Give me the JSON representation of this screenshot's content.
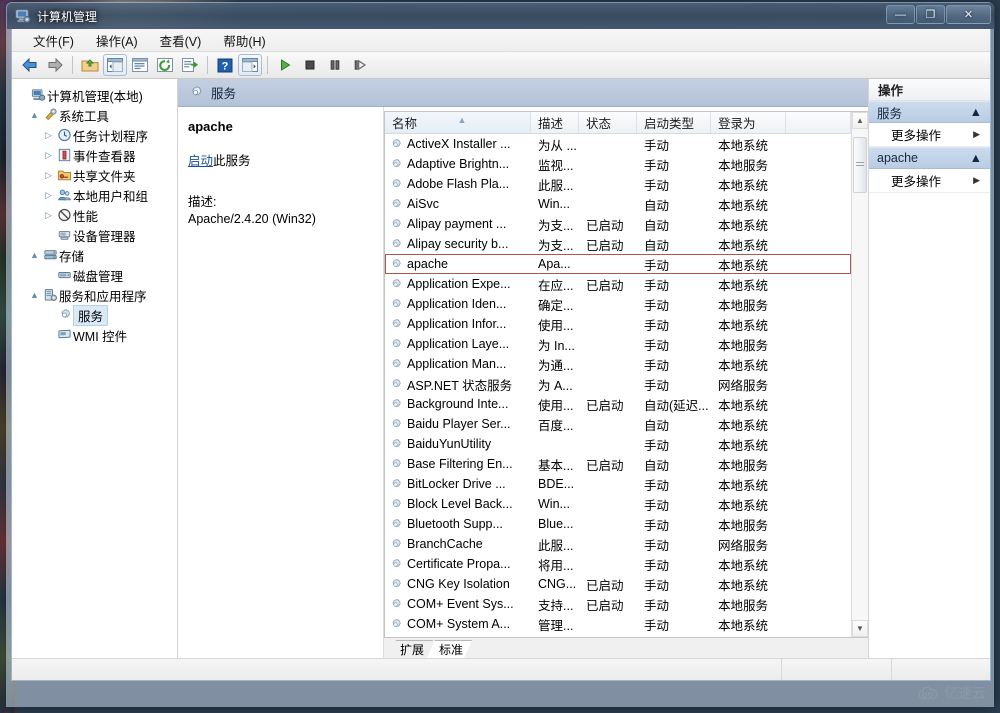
{
  "window": {
    "title": "计算机管理",
    "icon": "computer-management-icon",
    "buttons": {
      "minimize": "—",
      "maximize": "❐",
      "close": "✕"
    }
  },
  "menubar": {
    "items": [
      {
        "label": "文件(F)",
        "name": "menu-file"
      },
      {
        "label": "操作(A)",
        "name": "menu-action"
      },
      {
        "label": "查看(V)",
        "name": "menu-view"
      },
      {
        "label": "帮助(H)",
        "name": "menu-help"
      }
    ]
  },
  "toolbar": {
    "buttons": [
      {
        "name": "back-icon",
        "glyph": "back"
      },
      {
        "name": "forward-icon",
        "glyph": "forward"
      },
      {
        "name": "up-folder-icon",
        "glyph": "upfolder"
      },
      {
        "name": "show-hide-tree-icon",
        "glyph": "treepane"
      },
      {
        "name": "properties-icon",
        "glyph": "props"
      },
      {
        "name": "refresh-icon",
        "glyph": "refresh"
      },
      {
        "name": "export-list-icon",
        "glyph": "export"
      },
      {
        "name": "help-icon",
        "glyph": "help"
      },
      {
        "name": "show-action-pane-icon",
        "glyph": "actionpane"
      },
      {
        "name": "start-service-icon",
        "glyph": "play"
      },
      {
        "name": "stop-service-icon",
        "glyph": "stop"
      },
      {
        "name": "pause-service-icon",
        "glyph": "pause"
      },
      {
        "name": "restart-service-icon",
        "glyph": "restart"
      }
    ]
  },
  "tree": {
    "items": [
      {
        "label": "计算机管理(本地)",
        "indent": 0,
        "expander": "",
        "icon": "computer-icon",
        "name": "tree-computer-management"
      },
      {
        "label": "系统工具",
        "indent": 1,
        "expander": "▲",
        "icon": "tools-icon",
        "name": "tree-system-tools"
      },
      {
        "label": "任务计划程序",
        "indent": 2,
        "expander": "▷",
        "icon": "clock-icon",
        "name": "tree-task-scheduler"
      },
      {
        "label": "事件查看器",
        "indent": 2,
        "expander": "▷",
        "icon": "event-icon",
        "name": "tree-event-viewer"
      },
      {
        "label": "共享文件夹",
        "indent": 2,
        "expander": "▷",
        "icon": "shared-folder-icon",
        "name": "tree-shared-folders"
      },
      {
        "label": "本地用户和组",
        "indent": 2,
        "expander": "▷",
        "icon": "users-icon",
        "name": "tree-local-users-groups"
      },
      {
        "label": "性能",
        "indent": 2,
        "expander": "▷",
        "icon": "performance-icon",
        "name": "tree-performance"
      },
      {
        "label": "设备管理器",
        "indent": 2,
        "expander": "",
        "icon": "device-manager-icon",
        "name": "tree-device-manager"
      },
      {
        "label": "存储",
        "indent": 1,
        "expander": "▲",
        "icon": "storage-icon",
        "name": "tree-storage"
      },
      {
        "label": "磁盘管理",
        "indent": 2,
        "expander": "",
        "icon": "disk-icon",
        "name": "tree-disk-management"
      },
      {
        "label": "服务和应用程序",
        "indent": 1,
        "expander": "▲",
        "icon": "services-apps-icon",
        "name": "tree-services-applications"
      },
      {
        "label": "服务",
        "indent": 2,
        "expander": "",
        "icon": "gear-icon",
        "name": "tree-services",
        "selected": true
      },
      {
        "label": "WMI 控件",
        "indent": 2,
        "expander": "",
        "icon": "wmi-icon",
        "name": "tree-wmi-control"
      }
    ]
  },
  "services_header": {
    "title": "服务",
    "icon": "gear-icon"
  },
  "detail": {
    "service_name": "apache",
    "action_link": "启动",
    "action_suffix": "此服务",
    "description_label": "描述:",
    "description_value": "Apache/2.4.20 (Win32)"
  },
  "list": {
    "columns": [
      {
        "label": "名称",
        "key": "name",
        "sorted": true
      },
      {
        "label": "描述",
        "key": "description"
      },
      {
        "label": "状态",
        "key": "status"
      },
      {
        "label": "启动类型",
        "key": "startup"
      },
      {
        "label": "登录为",
        "key": "logon"
      }
    ],
    "rows": [
      {
        "name": "ActiveX Installer ...",
        "description": "为从 ...",
        "status": "",
        "startup": "手动",
        "logon": "本地系统"
      },
      {
        "name": "Adaptive Brightn...",
        "description": "监视...",
        "status": "",
        "startup": "手动",
        "logon": "本地服务"
      },
      {
        "name": "Adobe Flash Pla...",
        "description": "此服...",
        "status": "",
        "startup": "手动",
        "logon": "本地系统"
      },
      {
        "name": "AiSvc",
        "description": "Win...",
        "status": "",
        "startup": "自动",
        "logon": "本地系统"
      },
      {
        "name": "Alipay payment ...",
        "description": "为支...",
        "status": "已启动",
        "startup": "自动",
        "logon": "本地系统"
      },
      {
        "name": "Alipay security b...",
        "description": "为支...",
        "status": "已启动",
        "startup": "自动",
        "logon": "本地系统"
      },
      {
        "name": "apache",
        "description": "Apa...",
        "status": "",
        "startup": "手动",
        "logon": "本地系统",
        "selected": true
      },
      {
        "name": "Application Expe...",
        "description": "在应...",
        "status": "已启动",
        "startup": "手动",
        "logon": "本地系统"
      },
      {
        "name": "Application Iden...",
        "description": "确定...",
        "status": "",
        "startup": "手动",
        "logon": "本地服务"
      },
      {
        "name": "Application Infor...",
        "description": "使用...",
        "status": "",
        "startup": "手动",
        "logon": "本地系统"
      },
      {
        "name": "Application Laye...",
        "description": "为 In...",
        "status": "",
        "startup": "手动",
        "logon": "本地服务"
      },
      {
        "name": "Application Man...",
        "description": "为通...",
        "status": "",
        "startup": "手动",
        "logon": "本地系统"
      },
      {
        "name": "ASP.NET 状态服务",
        "description": "为 A...",
        "status": "",
        "startup": "手动",
        "logon": "网络服务"
      },
      {
        "name": "Background Inte...",
        "description": "使用...",
        "status": "已启动",
        "startup": "自动(延迟...",
        "logon": "本地系统"
      },
      {
        "name": "Baidu Player Ser...",
        "description": "百度...",
        "status": "",
        "startup": "自动",
        "logon": "本地系统"
      },
      {
        "name": "BaiduYunUtility",
        "description": "",
        "status": "",
        "startup": "手动",
        "logon": "本地系统"
      },
      {
        "name": "Base Filtering En...",
        "description": "基本...",
        "status": "已启动",
        "startup": "自动",
        "logon": "本地服务"
      },
      {
        "name": "BitLocker Drive ...",
        "description": "BDE...",
        "status": "",
        "startup": "手动",
        "logon": "本地系统"
      },
      {
        "name": "Block Level Back...",
        "description": "Win...",
        "status": "",
        "startup": "手动",
        "logon": "本地系统"
      },
      {
        "name": "Bluetooth Supp...",
        "description": "Blue...",
        "status": "",
        "startup": "手动",
        "logon": "本地服务"
      },
      {
        "name": "BranchCache",
        "description": "此服...",
        "status": "",
        "startup": "手动",
        "logon": "网络服务"
      },
      {
        "name": "Certificate Propa...",
        "description": "将用...",
        "status": "",
        "startup": "手动",
        "logon": "本地系统"
      },
      {
        "name": "CNG Key Isolation",
        "description": "CNG...",
        "status": "已启动",
        "startup": "手动",
        "logon": "本地系统"
      },
      {
        "name": "COM+ Event Sys...",
        "description": "支持...",
        "status": "已启动",
        "startup": "手动",
        "logon": "本地服务"
      },
      {
        "name": "COM+ System A...",
        "description": "管理...",
        "status": "",
        "startup": "手动",
        "logon": "本地系统"
      }
    ]
  },
  "view_tabs": [
    {
      "label": "扩展",
      "name": "tab-extended",
      "active": false
    },
    {
      "label": "标准",
      "name": "tab-standard",
      "active": true
    }
  ],
  "actions": {
    "header": "操作",
    "groups": [
      {
        "title": "服务",
        "name": "actions-group-services",
        "items": [
          {
            "label": "更多操作",
            "name": "more-actions-services"
          }
        ]
      },
      {
        "title": "apache",
        "name": "actions-group-apache",
        "items": [
          {
            "label": "更多操作",
            "name": "more-actions-apache"
          }
        ]
      }
    ],
    "collapse_glyph": "▲",
    "submenu_glyph": "▶"
  },
  "watermark": {
    "text": "亿速云"
  },
  "colors": {
    "selection_outline": "#b0584f",
    "header_band": "#b8c6dc",
    "action_group": "#c0d3e8",
    "link": "#1a4f9c"
  }
}
